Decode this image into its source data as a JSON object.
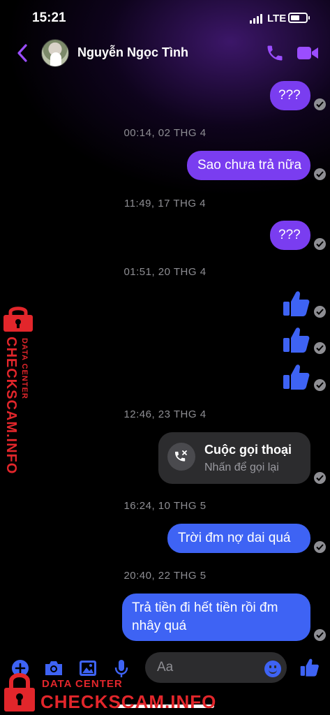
{
  "status_bar": {
    "time": "15:21",
    "network": "LTE"
  },
  "header": {
    "contact_name": "Nguyễn Ngọc Tình"
  },
  "messages": [
    {
      "text": "???"
    },
    {
      "timestamp": "00:14, 02 THG 4"
    },
    {
      "text": "Sao chưa trả nữa"
    },
    {
      "timestamp": "11:49, 17 THG 4"
    },
    {
      "text": "???"
    },
    {
      "timestamp": "01:51, 20 THG 4"
    },
    {
      "timestamp": "12:46, 23 THG 4"
    },
    {
      "timestamp": "16:24, 10 THG 5"
    },
    {
      "text": "Trời đm nợ dai quá"
    },
    {
      "timestamp": "20:40, 22 THG 5"
    },
    {
      "text": "Trả tiền đi hết tiền rồi đm nhây quá"
    }
  ],
  "call_card": {
    "title": "Cuộc gọi thoại",
    "subtitle": "Nhấn để gọi lại"
  },
  "composer": {
    "placeholder": "Aa"
  },
  "watermark": {
    "sub": "DATA CENTER",
    "main": "CHECKSCAM.INFO"
  },
  "colors": {
    "purple_bubble": "#7a3df0",
    "blue_bubble": "#3e63f4",
    "accent": "#9b4dff",
    "watermark": "#e2262b"
  },
  "icons": [
    "back-chevron-icon",
    "phone-icon",
    "video-camera-icon",
    "thumbs-up-icon",
    "missed-call-icon",
    "plus-icon",
    "camera-icon",
    "image-icon",
    "microphone-icon",
    "emoji-icon",
    "lock-icon",
    "read-check-icon"
  ]
}
